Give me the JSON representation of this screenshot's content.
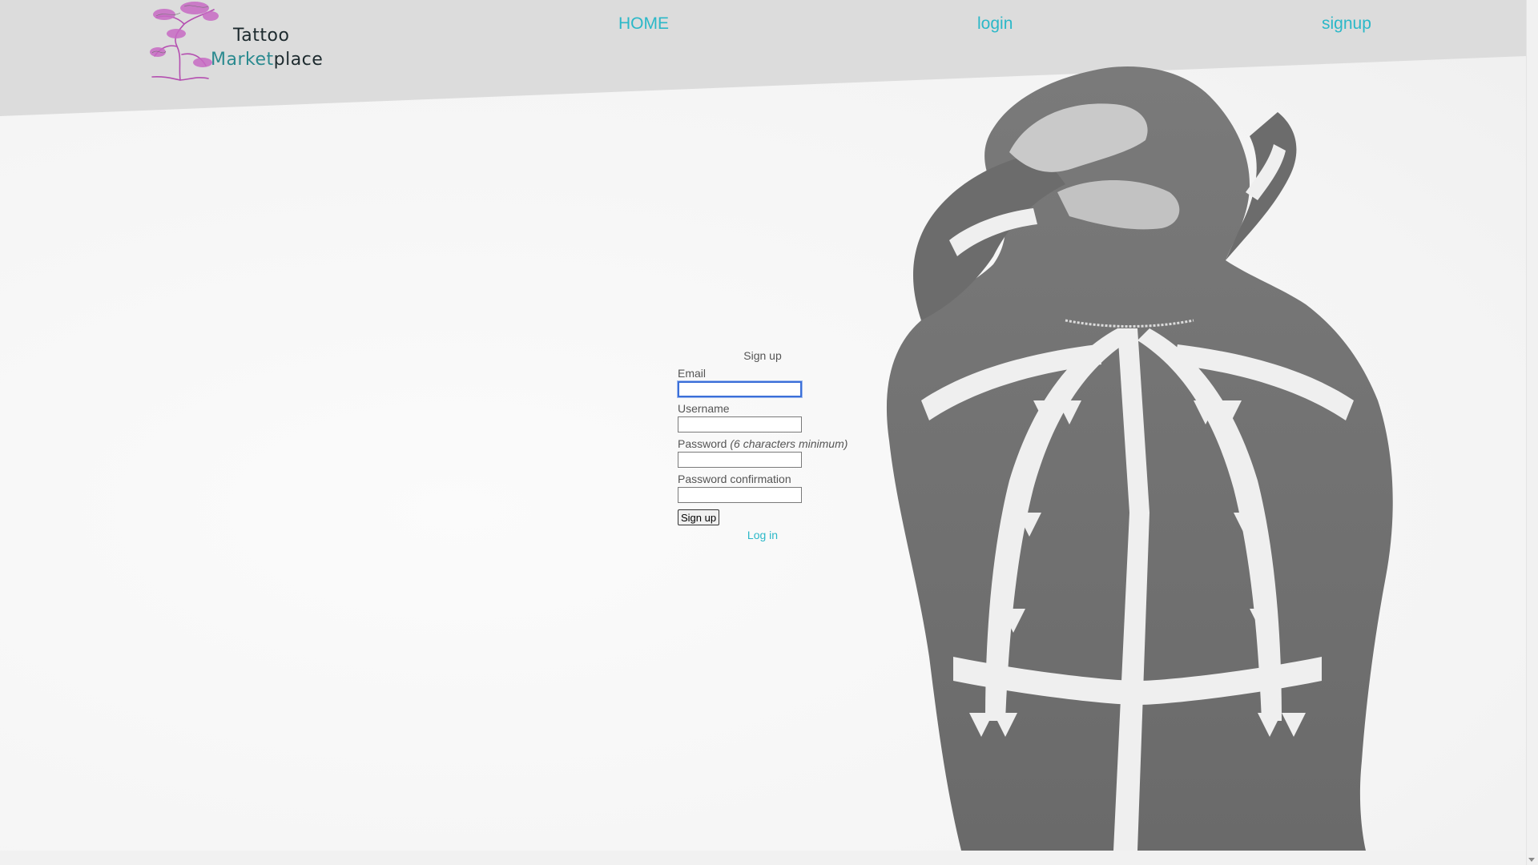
{
  "logo": {
    "line1": "Tattoo",
    "line2_a": "Market",
    "line2_b": "place",
    "icon": "bonsai-tree-icon",
    "tree_color": "#b44fb0"
  },
  "nav": {
    "home": "HOME",
    "login": "login",
    "signup": "signup",
    "link_color": "#2bb8c8"
  },
  "form": {
    "title": "Sign up",
    "email_label": "Email",
    "email_value": "",
    "username_label": "Username",
    "username_value": "",
    "password_label": "Password",
    "password_hint": "(6 characters minimum)",
    "password_value": "",
    "password_confirm_label": "Password confirmation",
    "password_confirm_value": "",
    "submit_label": "Sign up",
    "login_link": "Log in"
  },
  "colors": {
    "header_band": "#dcdcdc",
    "accent": "#2bb8c8",
    "focus_border": "#3b6fd8"
  }
}
